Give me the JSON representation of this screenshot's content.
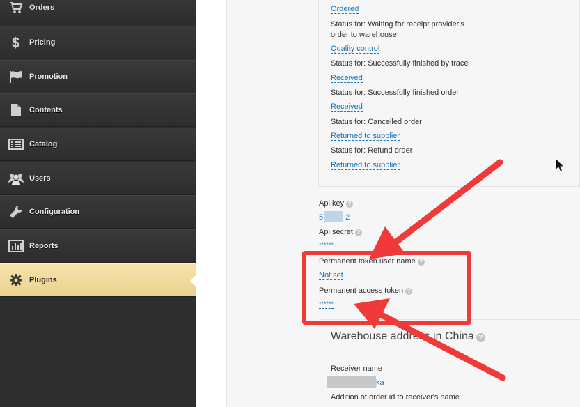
{
  "sidebar": {
    "items": [
      {
        "label": "Orders",
        "icon": "cart-icon"
      },
      {
        "label": "Pricing",
        "icon": "dollar-icon"
      },
      {
        "label": "Promotion",
        "icon": "flag-icon"
      },
      {
        "label": "Contents",
        "icon": "document-icon"
      },
      {
        "label": "Catalog",
        "icon": "list-icon"
      },
      {
        "label": "Users",
        "icon": "users-icon"
      },
      {
        "label": "Configuration",
        "icon": "wrench-icon"
      },
      {
        "label": "Reports",
        "icon": "bar-chart-icon"
      },
      {
        "label": "Plugins",
        "icon": "gear-icon",
        "active": true
      }
    ]
  },
  "statuses": {
    "ordered_link": "Ordered",
    "waiting_label_line1": "Status for: Waiting for receipt provider's",
    "waiting_label_line2": "order to warehouse",
    "waiting_value": "Quality control",
    "trace_label": "Status for: Successfully finished by trace",
    "trace_value": "Received",
    "finished_label": "Status for: Successfully finished order",
    "finished_value": "Received",
    "cancelled_label": "Status for: Cancelled order",
    "cancelled_value": "Returned to supplier",
    "refund_label": "Status for: Refund order",
    "refund_value": "Returned to supplier"
  },
  "api": {
    "key_label": "Api key",
    "key_value_start": "5",
    "key_value_end": "2",
    "secret_label": "Api secret",
    "secret_value": "******",
    "token_user_label": "Permanent token user name",
    "token_user_value": "Not set",
    "access_token_label": "Permanent access token",
    "access_token_value": "******"
  },
  "warehouse": {
    "title": "Warehouse address in China",
    "receiver_label": "Receiver name",
    "receiver_value_end": "ka",
    "order_id_label": "Addition of order id to receiver's name"
  },
  "help_glyph": "?",
  "colors": {
    "sidebar_bg": "#2e2e2e",
    "active_bg": "#ecd28f",
    "link": "#1a73b5",
    "annotation_red": "#f03a3a"
  }
}
